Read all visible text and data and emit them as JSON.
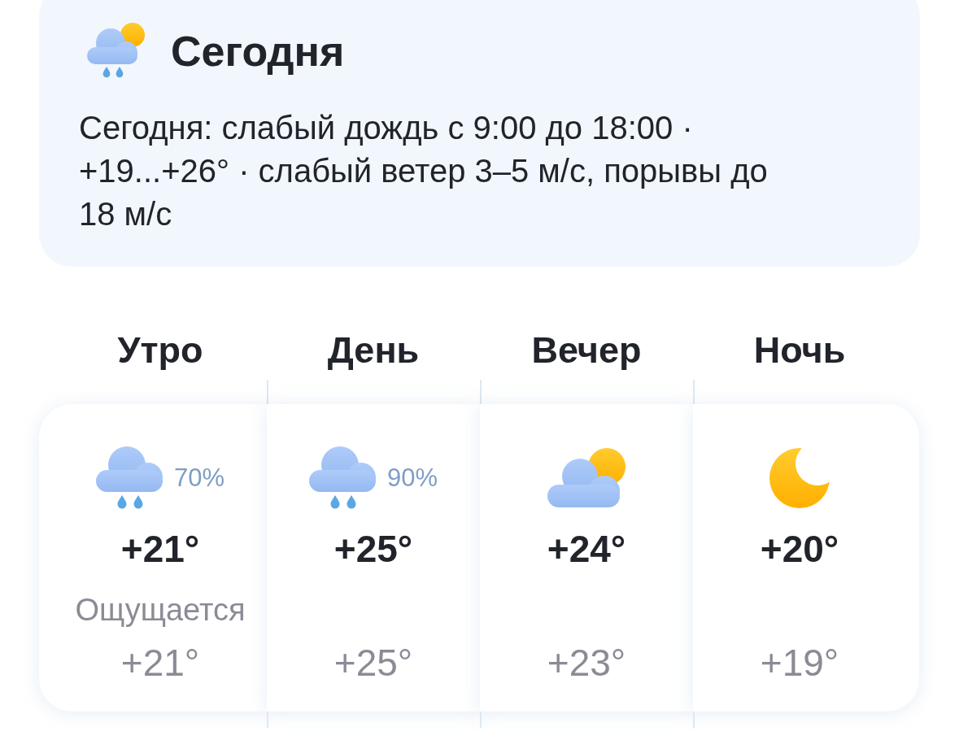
{
  "today": {
    "kind": "showers",
    "title": "Сегодня",
    "summary": "Сегодня: слабый дождь с 9:00 до 18:00 · +19...+26° · слабый ветер 3–5 м/с, порывы до 18 м/с"
  },
  "periods": {
    "feels_like_label": "Ощущается",
    "items": [
      {
        "label": "Утро",
        "kind": "rain",
        "precipitation": "70%",
        "temperature": "+21°",
        "feels_like": "+21°"
      },
      {
        "label": "День",
        "kind": "rain",
        "precipitation": "90%",
        "temperature": "+25°",
        "feels_like": "+25°"
      },
      {
        "label": "Вечер",
        "kind": "partlycloudy",
        "temperature": "+24°",
        "feels_like": "+23°"
      },
      {
        "label": "Ночь",
        "kind": "clearnight",
        "temperature": "+20°",
        "feels_like": "+19°"
      }
    ]
  }
}
